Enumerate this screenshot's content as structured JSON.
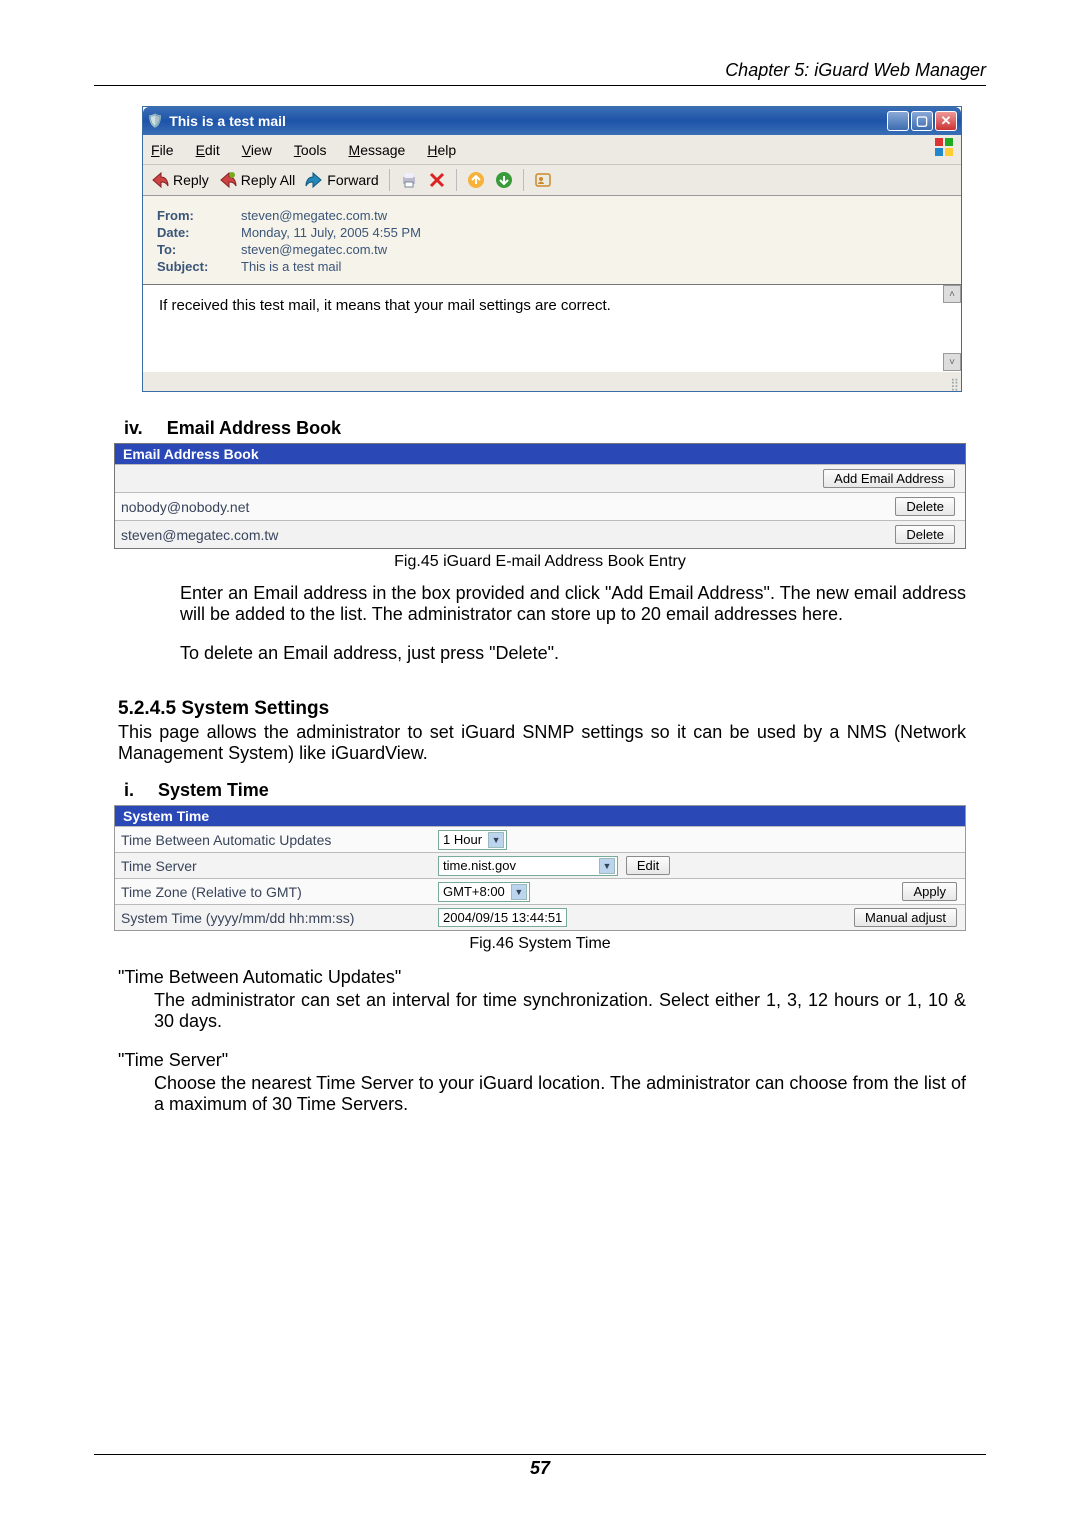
{
  "chapter_title": "Chapter 5: iGuard Web Manager",
  "page_number": "57",
  "mail": {
    "window_title": "This is a test mail",
    "menus": {
      "file": "File",
      "edit": "Edit",
      "view": "View",
      "tools": "Tools",
      "message": "Message",
      "help": "Help"
    },
    "toolbar": {
      "reply": "Reply",
      "reply_all": "Reply All",
      "forward": "Forward"
    },
    "hdr_labels": {
      "from": "From:",
      "date": "Date:",
      "to": "To:",
      "subject": "Subject:"
    },
    "hdr_values": {
      "from": "steven@megatec.com.tw",
      "date": "Monday, 11 July, 2005 4:55 PM",
      "to": "steven@megatec.com.tw",
      "subject": "This is a test mail"
    },
    "body": "If received this test mail, it means that your mail settings are correct."
  },
  "sec_iv": {
    "num": "iv.",
    "title": "Email Address Book"
  },
  "ab": {
    "header": "Email Address Book",
    "add_btn": "Add Email Address",
    "rows": [
      {
        "addr": "nobody@nobody.net",
        "btn": "Delete"
      },
      {
        "addr": "steven@megatec.com.tw",
        "btn": "Delete"
      }
    ]
  },
  "fig45": "Fig.45  iGuard E-mail Address Book Entry",
  "p_ab_1": "Enter an Email address in the box provided and click \"Add Email Address\". The new email address will be added to the list.   The administrator can store up to 20 email addresses here.",
  "p_ab_2": "To delete an Email address, just press \"Delete\".",
  "h_5245": "5.2.4.5 System Settings",
  "p_5245": "This page allows the administrator to set iGuard SNMP settings so it can be used by a NMS (Network Management System) like iGuardView.",
  "sec_i": {
    "num": "i.",
    "title": "System Time"
  },
  "st": {
    "header": "System Time",
    "rows": [
      {
        "label": "Time Between Automatic Updates",
        "val": "1 Hour",
        "btn": ""
      },
      {
        "label": "Time Server",
        "val": "time.nist.gov",
        "btn": "Edit"
      },
      {
        "label": "Time Zone (Relative to GMT)",
        "val": "GMT+8:00",
        "btn": "Apply"
      },
      {
        "label": "System Time (yyyy/mm/dd hh:mm:ss)",
        "val": "2004/09/15 13:44:51",
        "btn": "Manual adjust"
      }
    ]
  },
  "fig46": "Fig.46  System Time",
  "q_tbau": "\"Time Between Automatic Updates\"",
  "p_tbau": "The administrator can set an interval for time synchronization. Select either 1, 3, 12 hours or 1, 10 & 30 days.",
  "q_ts": "\"Time Server\"",
  "p_ts": "Choose the nearest Time Server to your iGuard location.  The administrator can choose from the list of a maximum of 30 Time Servers."
}
